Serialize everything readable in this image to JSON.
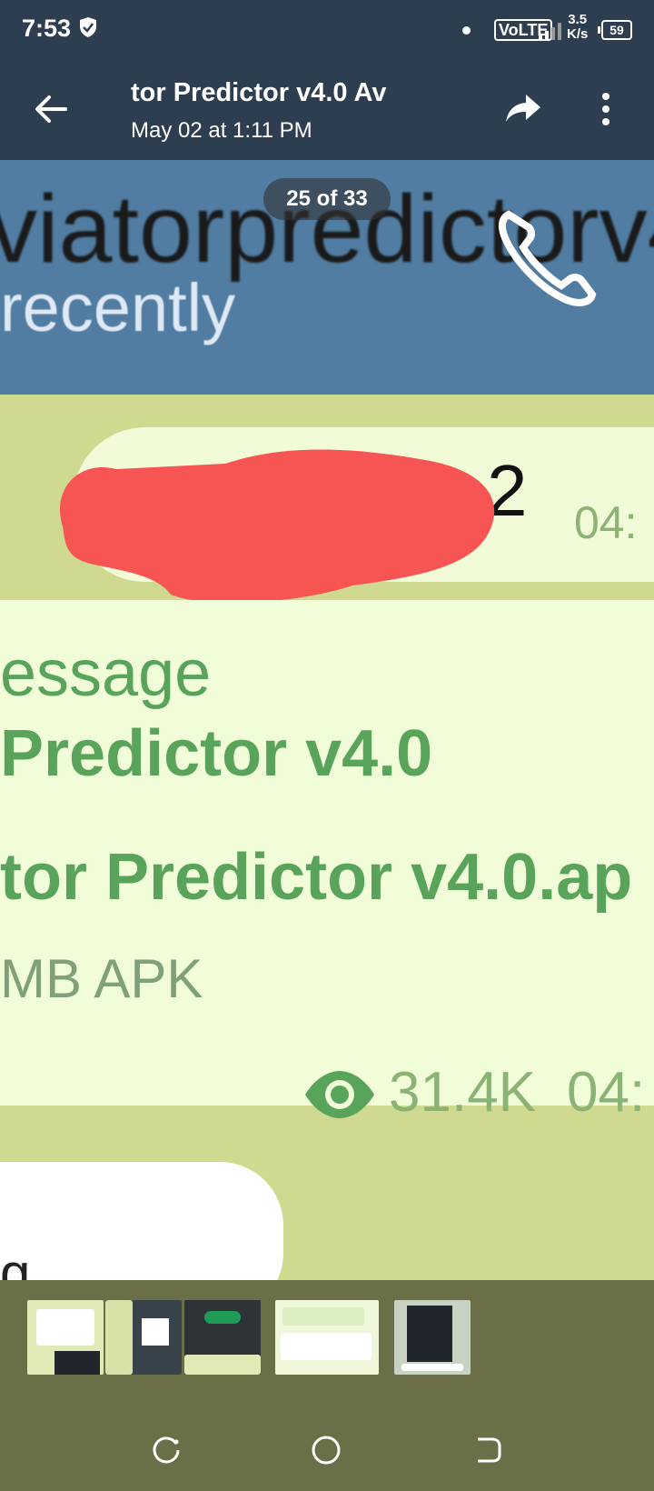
{
  "status_bar": {
    "time": "7:53",
    "network": "VoLTE",
    "speed_value": "3.5",
    "speed_unit": "K/s",
    "battery": "59"
  },
  "toolbar": {
    "title": "tor Predictor v4.0   Av",
    "subtitle": "May 02 at 1:11 PM"
  },
  "viewer": {
    "counter": "25 of 33"
  },
  "photo": {
    "chat_name": "viatorpredictorv4",
    "chat_status": "recently",
    "message_number": "2",
    "time_1": "04:",
    "message_line1": "essage",
    "message_line2": "Predictor v4.0",
    "file_name": "tor Predictor v4.0.ap",
    "file_size": "MB APK",
    "views": "31.4K",
    "time_2": "04:",
    "partial_text": "g"
  },
  "colors": {
    "header_bg": "#2d3e50",
    "chat_header": "#517da2",
    "message_green": "#5aa35b",
    "redaction": "#f75454",
    "strip_bg": "#6b6f48"
  }
}
